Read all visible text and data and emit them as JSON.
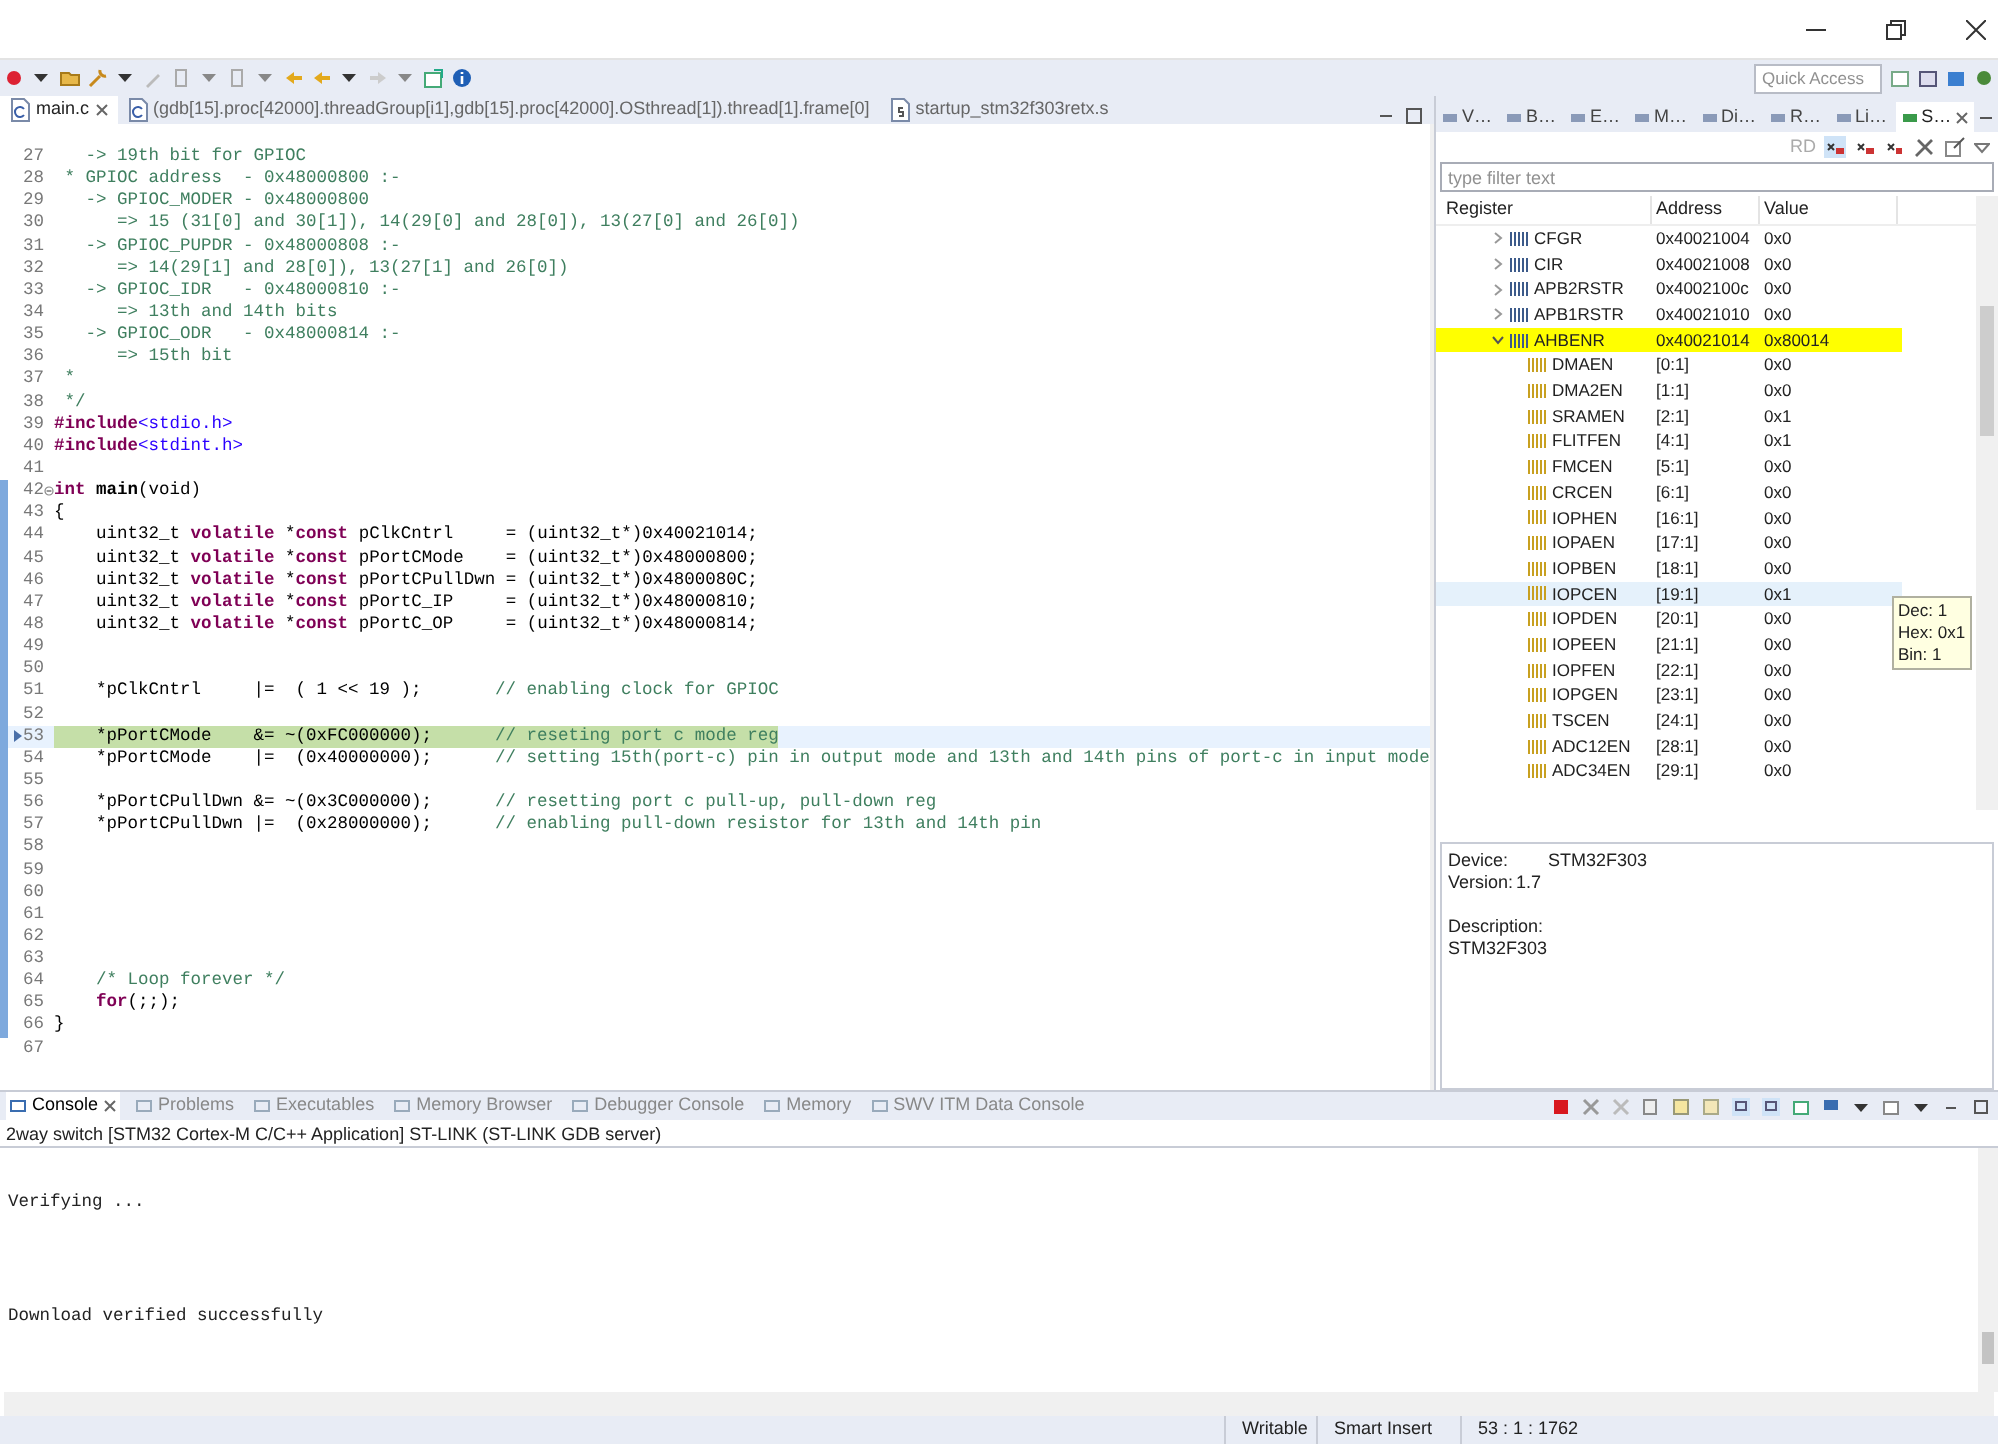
{
  "toolbar": {
    "quick_access": {
      "placeholder": "Quick Access"
    }
  },
  "editor": {
    "tabs": [
      {
        "label": "main.c",
        "selected": true,
        "kind": "c"
      },
      {
        "label": "(gdb[15].proc[42000].threadGroup[i1],gdb[15].proc[42000].OSthread[1]).thread[1].frame[0]",
        "selected": false,
        "kind": "c"
      },
      {
        "label": "startup_stm32f303retx.s",
        "selected": false,
        "kind": "asm"
      }
    ],
    "lines": [
      {
        "n": "27",
        "scope": false,
        "current": false,
        "fold": false,
        "parts": [
          {
            "kind": "comment",
            "text": "   -> 19th bit for GPIOC"
          }
        ]
      },
      {
        "n": "28",
        "scope": false,
        "current": false,
        "fold": false,
        "parts": [
          {
            "kind": "comment",
            "text": " * GPIOC address  - 0x48000800 :-"
          }
        ]
      },
      {
        "n": "29",
        "scope": false,
        "current": false,
        "fold": false,
        "parts": [
          {
            "kind": "comment",
            "text": "   -> GPIOC_MODER - 0x48000800"
          }
        ]
      },
      {
        "n": "30",
        "scope": false,
        "current": false,
        "fold": false,
        "parts": [
          {
            "kind": "comment",
            "text": "      => 15 (31[0] and 30[1]), 14(29[0] and 28[0]), 13(27[0] and 26[0])"
          }
        ]
      },
      {
        "n": "31",
        "scope": false,
        "current": false,
        "fold": false,
        "parts": [
          {
            "kind": "comment",
            "text": "   -> GPIOC_PUPDR - 0x48000808 :-"
          }
        ]
      },
      {
        "n": "32",
        "scope": false,
        "current": false,
        "fold": false,
        "parts": [
          {
            "kind": "comment",
            "text": "      => 14(29[1] and 28[0]), 13(27[1] and 26[0])"
          }
        ]
      },
      {
        "n": "33",
        "scope": false,
        "current": false,
        "fold": false,
        "parts": [
          {
            "kind": "comment",
            "text": "   -> GPIOC_IDR   - 0x48000810 :-"
          }
        ]
      },
      {
        "n": "34",
        "scope": false,
        "current": false,
        "fold": false,
        "parts": [
          {
            "kind": "comment",
            "text": "      => 13th and 14th bits"
          }
        ]
      },
      {
        "n": "35",
        "scope": false,
        "current": false,
        "fold": false,
        "parts": [
          {
            "kind": "comment",
            "text": "   -> GPIOC_ODR   - 0x48000814 :-"
          }
        ]
      },
      {
        "n": "36",
        "scope": false,
        "current": false,
        "fold": false,
        "parts": [
          {
            "kind": "comment",
            "text": "      => 15th bit"
          }
        ]
      },
      {
        "n": "37",
        "scope": false,
        "current": false,
        "fold": false,
        "parts": [
          {
            "kind": "comment",
            "text": " *"
          }
        ]
      },
      {
        "n": "38",
        "scope": false,
        "current": false,
        "fold": false,
        "parts": [
          {
            "kind": "comment",
            "text": " */"
          }
        ]
      },
      {
        "n": "39",
        "scope": false,
        "current": false,
        "fold": false,
        "parts": [
          {
            "kind": "preproc",
            "text": "#include"
          },
          {
            "kind": "include",
            "text": "<stdio.h>"
          }
        ]
      },
      {
        "n": "40",
        "scope": false,
        "current": false,
        "fold": false,
        "parts": [
          {
            "kind": "preproc",
            "text": "#include"
          },
          {
            "kind": "include",
            "text": "<stdint.h>"
          }
        ]
      },
      {
        "n": "41",
        "scope": false,
        "current": false,
        "fold": false
      },
      {
        "n": "42",
        "scope": true,
        "current": false,
        "fold": true,
        "parts": [
          {
            "kind": "keyword",
            "text": "int"
          },
          {
            "kind": "function",
            "text": " main"
          },
          {
            "kind": "plain",
            "text": "(void)"
          }
        ]
      },
      {
        "n": "43",
        "scope": true,
        "current": false,
        "fold": false,
        "parts": [
          {
            "kind": "plain",
            "text": "{"
          }
        ]
      },
      {
        "n": "44",
        "scope": true,
        "current": false,
        "fold": false,
        "parts": [
          {
            "kind": "plain",
            "text": "    uint32_t "
          },
          {
            "kind": "keyword",
            "text": "volatile"
          },
          {
            "kind": "plain",
            "text": " *"
          },
          {
            "kind": "keyword",
            "text": "const"
          },
          {
            "kind": "plain",
            "text": " pClkCntrl     = (uint32_t*)0x40021014;"
          }
        ]
      },
      {
        "n": "45",
        "scope": true,
        "current": false,
        "fold": false,
        "parts": [
          {
            "kind": "plain",
            "text": "    uint32_t "
          },
          {
            "kind": "keyword",
            "text": "volatile"
          },
          {
            "kind": "plain",
            "text": " *"
          },
          {
            "kind": "keyword",
            "text": "const"
          },
          {
            "kind": "plain",
            "text": " pPortCMode    = (uint32_t*)0x48000800;"
          }
        ]
      },
      {
        "n": "46",
        "scope": true,
        "current": false,
        "fold": false,
        "parts": [
          {
            "kind": "plain",
            "text": "    uint32_t "
          },
          {
            "kind": "keyword",
            "text": "volatile"
          },
          {
            "kind": "plain",
            "text": " *"
          },
          {
            "kind": "keyword",
            "text": "const"
          },
          {
            "kind": "plain",
            "text": " pPortCPullDwn = (uint32_t*)0x4800080C;"
          }
        ]
      },
      {
        "n": "47",
        "scope": true,
        "current": false,
        "fold": false,
        "parts": [
          {
            "kind": "plain",
            "text": "    uint32_t "
          },
          {
            "kind": "keyword",
            "text": "volatile"
          },
          {
            "kind": "plain",
            "text": " *"
          },
          {
            "kind": "keyword",
            "text": "const"
          },
          {
            "kind": "plain",
            "text": " pPortC_IP     = (uint32_t*)0x48000810;"
          }
        ]
      },
      {
        "n": "48",
        "scope": true,
        "current": false,
        "fold": false,
        "parts": [
          {
            "kind": "plain",
            "text": "    uint32_t "
          },
          {
            "kind": "keyword",
            "text": "volatile"
          },
          {
            "kind": "plain",
            "text": " *"
          },
          {
            "kind": "keyword",
            "text": "const"
          },
          {
            "kind": "plain",
            "text": " pPortC_OP     = (uint32_t*)0x48000814;"
          }
        ]
      },
      {
        "n": "49",
        "scope": true,
        "current": false,
        "fold": false
      },
      {
        "n": "50",
        "scope": true,
        "current": false,
        "fold": false
      },
      {
        "n": "51",
        "scope": true,
        "current": false,
        "fold": false,
        "parts": [
          {
            "kind": "plain",
            "text": "    *pClkCntrl     |=  ( 1 << 19 );       "
          },
          {
            "kind": "comment",
            "text": "// enabling clock for GPIOC"
          }
        ]
      },
      {
        "n": "52",
        "scope": true,
        "current": false,
        "fold": false
      },
      {
        "n": "53",
        "scope": true,
        "current": true,
        "fold": false,
        "parts": [
          {
            "kind": "plain",
            "text": "    *pPortCMode    &= ~(0xFC000000);      "
          },
          {
            "kind": "comment",
            "text": "// reseting port c mode reg"
          }
        ]
      },
      {
        "n": "54",
        "scope": true,
        "current": false,
        "fold": false,
        "parts": [
          {
            "kind": "plain",
            "text": "    *pPortCMode    |=  (0x40000000);      "
          },
          {
            "kind": "comment",
            "text": "// setting 15th(port-c) pin in output mode and 13th and 14th pins of port-c in input mode"
          }
        ]
      },
      {
        "n": "55",
        "scope": true,
        "current": false,
        "fold": false
      },
      {
        "n": "56",
        "scope": true,
        "current": false,
        "fold": false,
        "parts": [
          {
            "kind": "plain",
            "text": "    *pPortCPullDwn &= ~(0x3C000000);      "
          },
          {
            "kind": "comment",
            "text": "// resetting port c pull-up, pull-down reg"
          }
        ]
      },
      {
        "n": "57",
        "scope": true,
        "current": false,
        "fold": false,
        "parts": [
          {
            "kind": "plain",
            "text": "    *pPortCPullDwn |=  (0x28000000);      "
          },
          {
            "kind": "comment",
            "text": "// enabling pull-down resistor for 13th and 14th pin"
          }
        ]
      },
      {
        "n": "58",
        "scope": true,
        "current": false,
        "fold": false
      },
      {
        "n": "59",
        "scope": true,
        "current": false,
        "fold": false
      },
      {
        "n": "60",
        "scope": true,
        "current": false,
        "fold": false
      },
      {
        "n": "61",
        "scope": true,
        "current": false,
        "fold": false
      },
      {
        "n": "62",
        "scope": true,
        "current": false,
        "fold": false
      },
      {
        "n": "63",
        "scope": true,
        "current": false,
        "fold": false
      },
      {
        "n": "64",
        "scope": true,
        "current": false,
        "fold": false,
        "parts": [
          {
            "kind": "comment",
            "text": "    /* Loop forever */"
          }
        ]
      },
      {
        "n": "65",
        "scope": true,
        "current": false,
        "fold": false,
        "parts": [
          {
            "kind": "keyword",
            "text": "    for"
          },
          {
            "kind": "plain",
            "text": "(;;);"
          }
        ]
      },
      {
        "n": "66",
        "scope": true,
        "current": false,
        "fold": false,
        "parts": [
          {
            "kind": "plain",
            "text": "}"
          }
        ]
      },
      {
        "n": "67",
        "scope": false,
        "current": false,
        "fold": false
      }
    ]
  },
  "sfr_view": {
    "tabs": [
      {
        "label": "V…",
        "selected": false
      },
      {
        "label": "B…",
        "selected": false
      },
      {
        "label": "E…",
        "selected": false
      },
      {
        "label": "M…",
        "selected": false
      },
      {
        "label": "Di…",
        "selected": false
      },
      {
        "label": "R…",
        "selected": false
      },
      {
        "label": "Li…",
        "selected": false
      },
      {
        "label": "S…",
        "selected": true
      }
    ],
    "toolbar": {
      "read_button": "RD"
    },
    "filter": {
      "placeholder": "type filter text"
    },
    "columns": [
      "Register",
      "Address",
      "Value"
    ],
    "rows": [
      {
        "kind": "register",
        "name": "CFGR",
        "address": "0x40021004",
        "value": "0x0",
        "expanded": false,
        "selected": false,
        "hovered": false
      },
      {
        "kind": "register",
        "name": "CIR",
        "address": "0x40021008",
        "value": "0x0",
        "expanded": false,
        "selected": false,
        "hovered": false
      },
      {
        "kind": "register",
        "name": "APB2RSTR",
        "address": "0x4002100c",
        "value": "0x0",
        "expanded": false,
        "selected": false,
        "hovered": false
      },
      {
        "kind": "register",
        "name": "APB1RSTR",
        "address": "0x40021010",
        "value": "0x0",
        "expanded": false,
        "selected": false,
        "hovered": false
      },
      {
        "kind": "register",
        "name": "AHBENR",
        "address": "0x40021014",
        "value": "0x80014",
        "expanded": true,
        "selected": true,
        "hovered": false
      },
      {
        "kind": "field",
        "name": "DMAEN",
        "address": "[0:1]",
        "value": "0x0",
        "selected": false,
        "hovered": false
      },
      {
        "kind": "field",
        "name": "DMA2EN",
        "address": "[1:1]",
        "value": "0x0",
        "selected": false,
        "hovered": false
      },
      {
        "kind": "field",
        "name": "SRAMEN",
        "address": "[2:1]",
        "value": "0x1",
        "selected": false,
        "hovered": false
      },
      {
        "kind": "field",
        "name": "FLITFEN",
        "address": "[4:1]",
        "value": "0x1",
        "selected": false,
        "hovered": false
      },
      {
        "kind": "field",
        "name": "FMCEN",
        "address": "[5:1]",
        "value": "0x0",
        "selected": false,
        "hovered": false
      },
      {
        "kind": "field",
        "name": "CRCEN",
        "address": "[6:1]",
        "value": "0x0",
        "selected": false,
        "hovered": false
      },
      {
        "kind": "field",
        "name": "IOPHEN",
        "address": "[16:1]",
        "value": "0x0",
        "selected": false,
        "hovered": false
      },
      {
        "kind": "field",
        "name": "IOPAEN",
        "address": "[17:1]",
        "value": "0x0",
        "selected": false,
        "hovered": false
      },
      {
        "kind": "field",
        "name": "IOPBEN",
        "address": "[18:1]",
        "value": "0x0",
        "selected": false,
        "hovered": false
      },
      {
        "kind": "field",
        "name": "IOPCEN",
        "address": "[19:1]",
        "value": "0x1",
        "selected": false,
        "hovered": true
      },
      {
        "kind": "field",
        "name": "IOPDEN",
        "address": "[20:1]",
        "value": "0x0",
        "selected": false,
        "hovered": false
      },
      {
        "kind": "field",
        "name": "IOPEEN",
        "address": "[21:1]",
        "value": "0x0",
        "selected": false,
        "hovered": false
      },
      {
        "kind": "field",
        "name": "IOPFEN",
        "address": "[22:1]",
        "value": "0x0",
        "selected": false,
        "hovered": false
      },
      {
        "kind": "field",
        "name": "IOPGEN",
        "address": "[23:1]",
        "value": "0x0",
        "selected": false,
        "hovered": false
      },
      {
        "kind": "field",
        "name": "TSCEN",
        "address": "[24:1]",
        "value": "0x0",
        "selected": false,
        "hovered": false
      },
      {
        "kind": "field",
        "name": "ADC12EN",
        "address": "[28:1]",
        "value": "0x0",
        "selected": false,
        "hovered": false
      },
      {
        "kind": "field",
        "name": "ADC34EN",
        "address": "[29:1]",
        "value": "0x0",
        "selected": false,
        "hovered": false
      }
    ],
    "tooltip": [
      "Dec: 1",
      "Hex: 0x1",
      "Bin: 1"
    ],
    "info": {
      "device_label": "Device:",
      "device": "STM32F303",
      "version_label": "Version:",
      "version": "1.7",
      "description_label": "Description:",
      "description": "STM32F303"
    }
  },
  "console": {
    "tabs": [
      {
        "label": "Console",
        "selected": true
      },
      {
        "label": "Problems",
        "selected": false
      },
      {
        "label": "Executables",
        "selected": false
      },
      {
        "label": "Memory Browser",
        "selected": false
      },
      {
        "label": "Debugger Console",
        "selected": false
      },
      {
        "label": "Memory",
        "selected": false
      },
      {
        "label": "SWV ITM Data Console",
        "selected": false
      }
    ],
    "header": "2way switch [STM32 Cortex-M C/C++ Application] ST-LINK (ST-LINK GDB server)",
    "output": [
      "Verifying ...",
      "Download verified successfully"
    ]
  },
  "status_bar": [
    "Writable",
    "Smart Insert",
    "53 : 1 : 1762"
  ]
}
